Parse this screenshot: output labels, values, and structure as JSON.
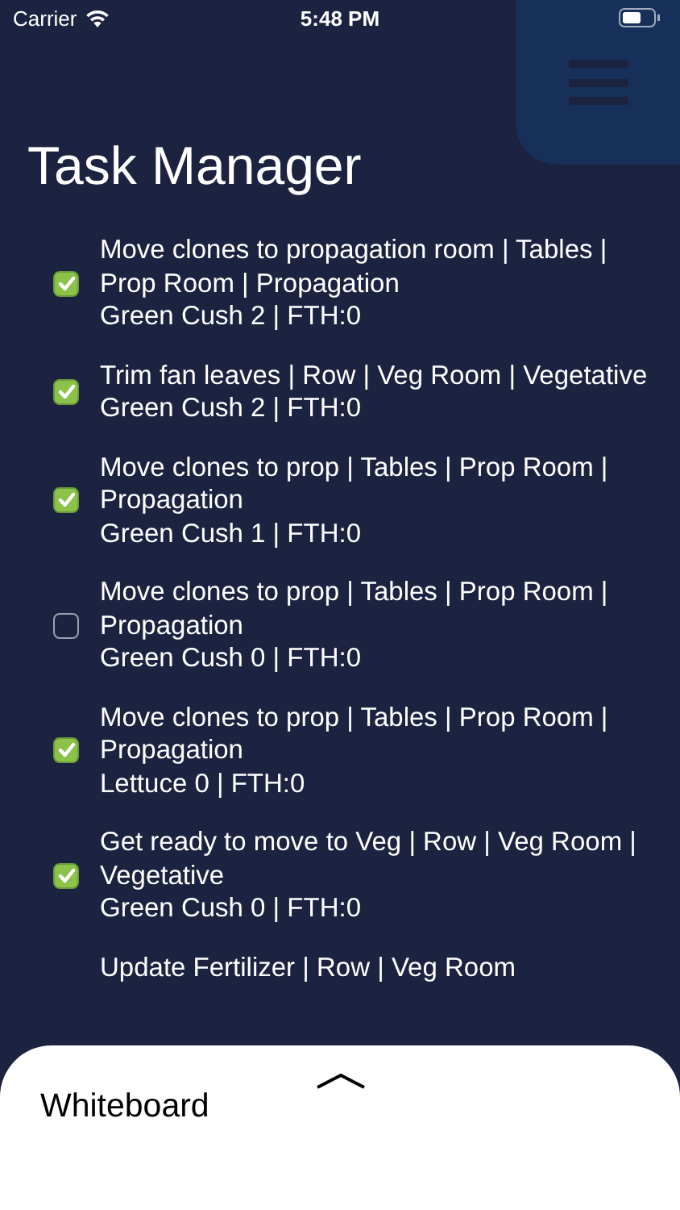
{
  "status_bar": {
    "carrier": "Carrier",
    "time": "5:48 PM"
  },
  "title": "Task Manager",
  "tasks": [
    {
      "title": "Move clones to propagation room | Tables | Prop Room | Propagation",
      "detail": "Green Cush 2 | FTH:0",
      "checked": true
    },
    {
      "title": "Trim fan leaves | Row | Veg Room | Vegetative",
      "detail": "Green Cush 2 | FTH:0",
      "checked": true
    },
    {
      "title": "Move clones to prop | Tables | Prop Room | Propagation",
      "detail": "Green Cush 1 | FTH:0",
      "checked": true
    },
    {
      "title": "Move clones to prop | Tables | Prop Room | Propagation",
      "detail": "Green Cush 0 | FTH:0",
      "checked": false
    },
    {
      "title": "Move clones to prop | Tables | Prop Room | Propagation",
      "detail": "Lettuce 0 | FTH:0",
      "checked": true
    },
    {
      "title": "Get ready to move to Veg | Row | Veg Room | Vegetative",
      "detail": "Green Cush 0 | FTH:0",
      "checked": true
    }
  ],
  "cut_off_task": {
    "title": "Update Fertilizer | Row | Veg Room"
  },
  "bottom_sheet": {
    "title": "Whiteboard"
  }
}
